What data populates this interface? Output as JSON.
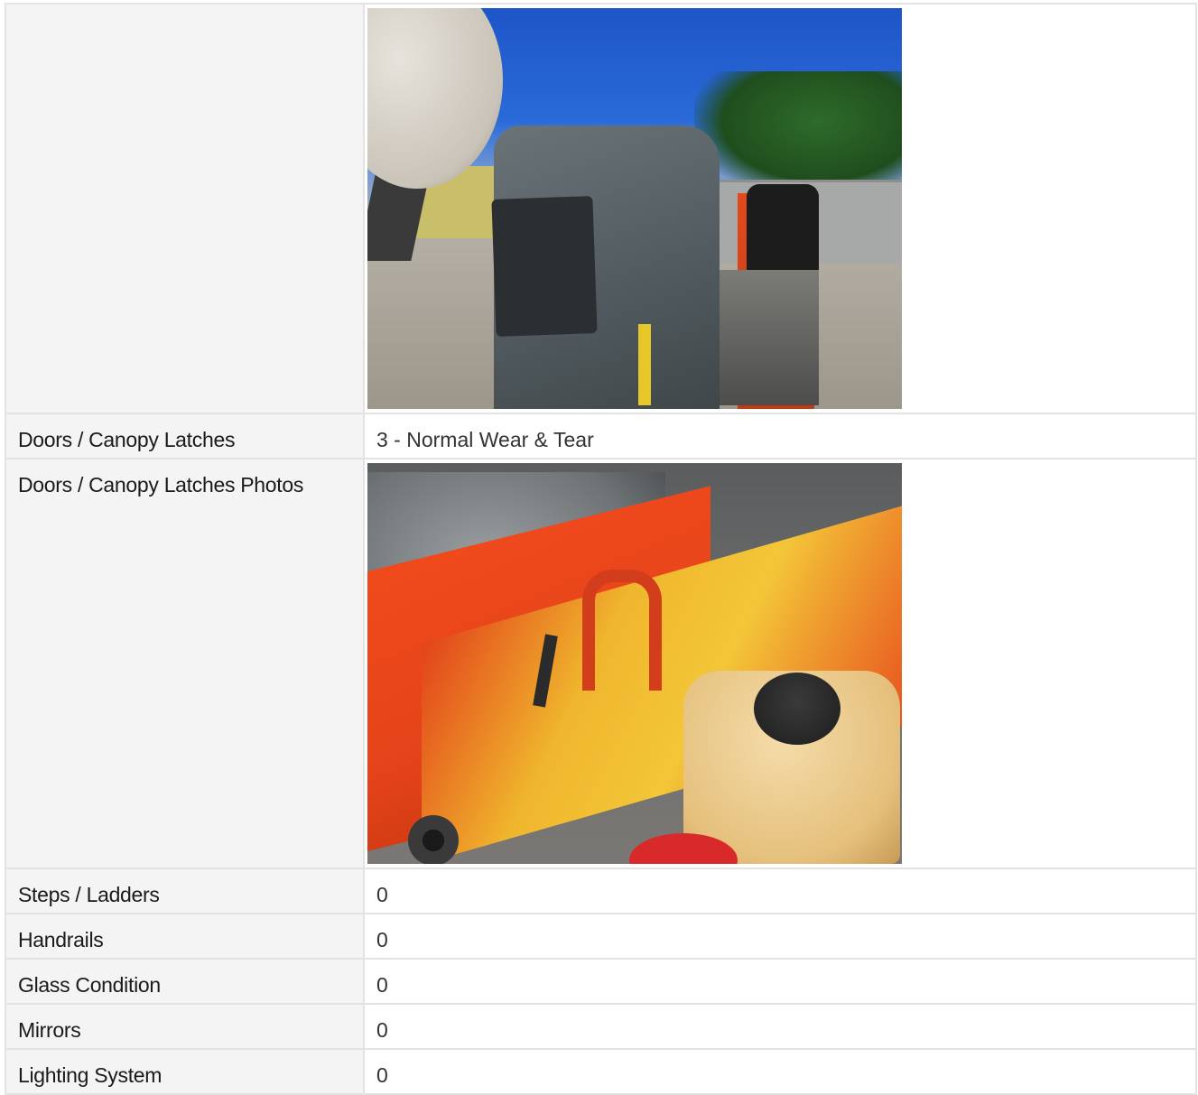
{
  "rows": [
    {
      "label": "",
      "type": "photo",
      "photo_icon": "canopy-photo"
    },
    {
      "label": "Doors / Canopy Latches",
      "value": "3 - Normal Wear & Tear"
    },
    {
      "label": "Doors / Canopy Latches Photos",
      "type": "photo",
      "photo_icon": "engine-bay-photo"
    },
    {
      "label": "Steps / Ladders",
      "value": "0"
    },
    {
      "label": "Handrails",
      "value": "0"
    },
    {
      "label": "Glass Condition",
      "value": "0"
    },
    {
      "label": "Mirrors",
      "value": "0"
    },
    {
      "label": "Lighting System",
      "value": "0"
    }
  ]
}
